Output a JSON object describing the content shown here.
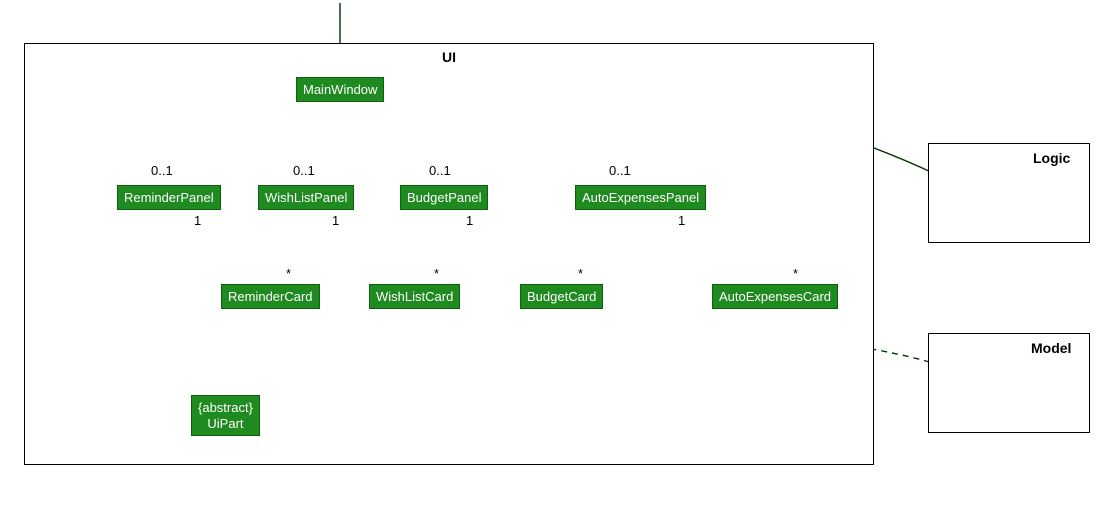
{
  "diagram_type": "UML class diagram",
  "packages": {
    "ui": {
      "label": "UI"
    },
    "logic": {
      "label": "Logic"
    },
    "model": {
      "label": "Model"
    }
  },
  "nodes": {
    "mainwindow": "MainWindow",
    "reminderpanel": "ReminderPanel",
    "wishlistpanel": "WishListPanel",
    "budgetpanel": "BudgetPanel",
    "autoexpensespanel": "AutoExpensesPanel",
    "remindercard": "ReminderCard",
    "wishlistcard": "WishListCard",
    "budgetcard": "BudgetCard",
    "autoexpensescard": "AutoExpensesCard",
    "uipart_stereo": "{abstract}",
    "uipart_name": "UiPart"
  },
  "multiplicities": {
    "mw_reminderpanel": "0..1",
    "mw_wishlistpanel": "0..1",
    "mw_budgetpanel": "0..1",
    "mw_autoexpensespanel": "0..1",
    "reminderpanel_card_one": "1",
    "wishlistpanel_card_one": "1",
    "budgetpanel_card_one": "1",
    "autoexpensespanel_card_one": "1",
    "remindercard_many": "*",
    "wishlistcard_many": "*",
    "budgetcard_many": "*",
    "autoexpensescard_many": "*"
  }
}
